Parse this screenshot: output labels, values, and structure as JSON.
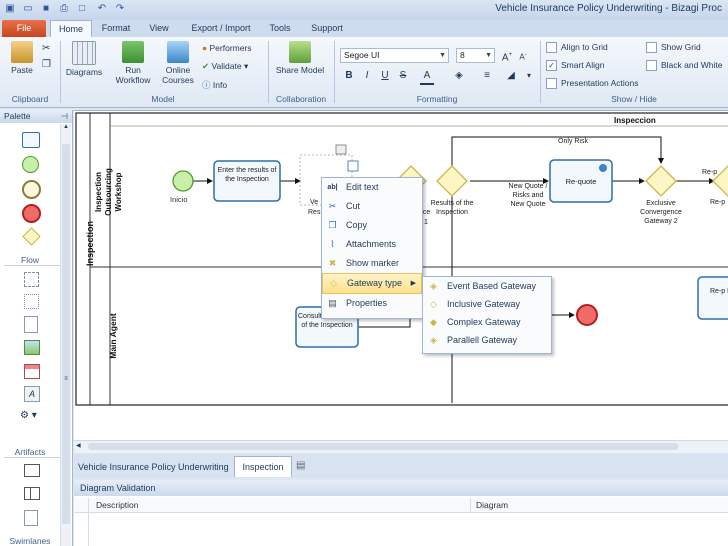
{
  "window": {
    "title": "Vehicle Insurance Policy Underwriting - Bizagi Proc"
  },
  "tabs": [
    "File",
    "Home",
    "Format",
    "View",
    "Export / Import",
    "Tools",
    "Support"
  ],
  "ribbon": {
    "clipboard": {
      "paste": "Paste",
      "group": "Clipboard"
    },
    "model": {
      "diagrams": "Diagrams",
      "run_workflow_1": "Run",
      "run_workflow_2": "Workflow",
      "online_courses_1": "Online",
      "online_courses_2": "Courses",
      "performers": "Performers",
      "validate": "Validate",
      "info": "Info",
      "group": "Model"
    },
    "collaboration": {
      "share_model": "Share Model",
      "group": "Collaboration"
    },
    "formatting": {
      "font": "Segoe UI",
      "size": "8",
      "group": "Formatting",
      "bold": "B",
      "italic": "I",
      "underline": "U",
      "strike": "S",
      "font_color": "A"
    },
    "show_hide": {
      "align_grid": "Align to Grid",
      "smart_align": "Smart Align",
      "presentation_actions": "Presentation Actions",
      "show_grid": "Show Grid",
      "black_white": "Black and White",
      "group": "Show / Hide",
      "smart_align_checked": true
    }
  },
  "palette": {
    "title": "Palette",
    "flow": "Flow",
    "artifacts": "Artifacts",
    "swimlanes": "Swimlanes"
  },
  "diagram": {
    "pool": "Inspection",
    "lane1": "Inspection Outsourcing Workshop",
    "lane2": "Main Agent",
    "phase": "Inspeccion",
    "start": "Inicio",
    "task1": "Enter the results of the Inspection",
    "task2": "Re-quote",
    "task3": "Consult the results of the Inspection",
    "task_right1": "Re-p",
    "task_right2": "Re-p R",
    "only_risk": "Only Risk",
    "new_quote": "New Quote / Risks and New Quote",
    "results_label": "Results of the Inspection",
    "exclusive": "Exclusive Convergence Gateway 2",
    "partial_ve": "Ve",
    "partial_res": "Res",
    "partial_nce": "nce",
    "partial_1": "1",
    "partial_rep": "Re-p"
  },
  "context_menu": {
    "items": [
      "Edit text",
      "Cut",
      "Copy",
      "Attachments",
      "Show marker",
      "Gateway type",
      "Properties"
    ],
    "sub_items": [
      "Event Based Gateway",
      "Inclusive Gateway",
      "Complex Gateway",
      "Parallell Gateway"
    ]
  },
  "doc_tabs": [
    "Vehicle Insurance Policy Underwriting",
    "Inspection"
  ],
  "validation": {
    "title": "Diagram Validation",
    "col1": "Description",
    "col2": "Diagram"
  },
  "colors": {
    "accent": "#e8704b",
    "task_border": "#2f6ea8",
    "gateway": "#fbf6c4",
    "gateway_border": "#c9b94a",
    "start": "#c8f0a8",
    "end": "#f06a6a",
    "menu_highlight": "#fde08a"
  }
}
